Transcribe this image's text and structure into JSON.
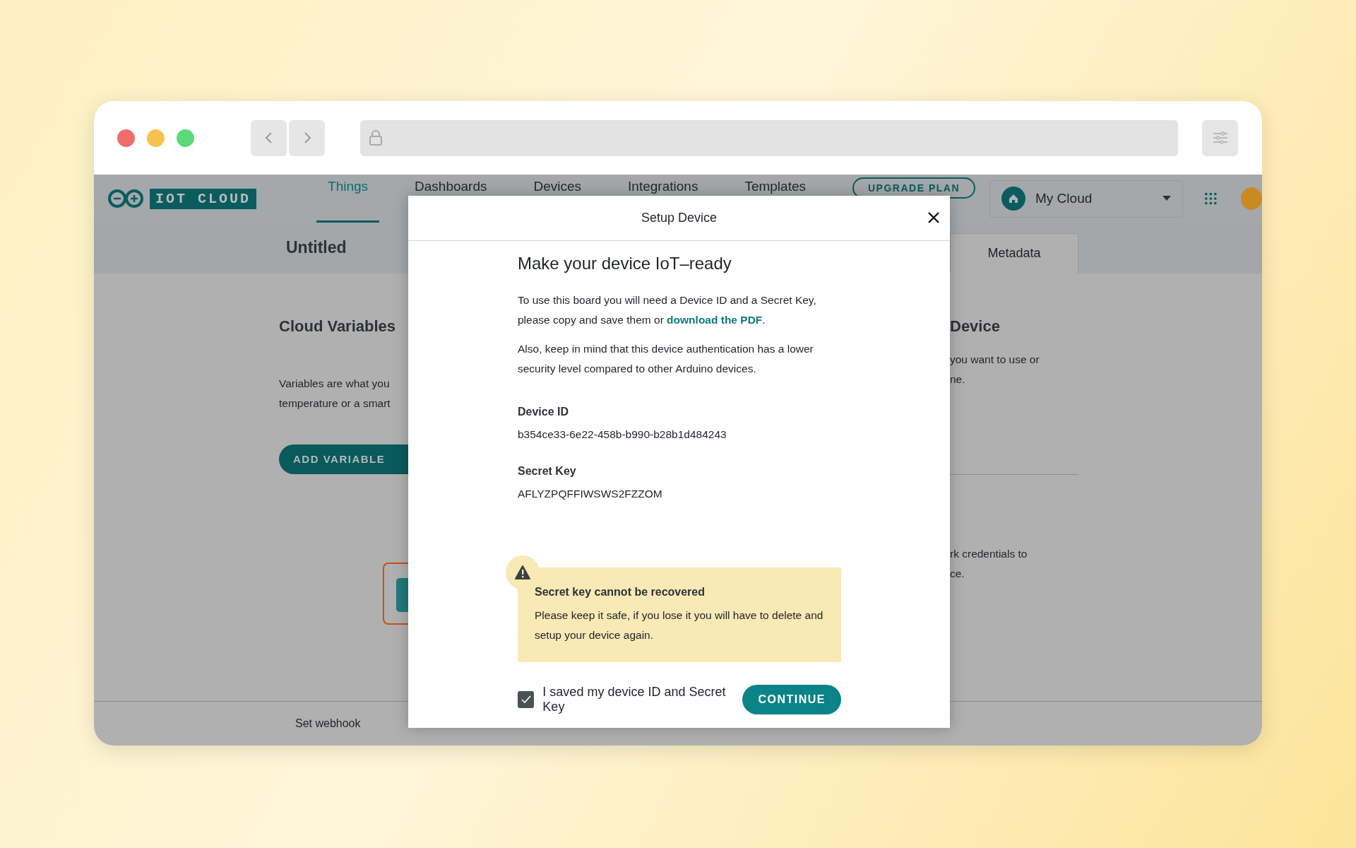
{
  "browser": {
    "traffic_lights": [
      {
        "color": "#f26b6b"
      },
      {
        "color": "#f6c24f"
      },
      {
        "color": "#5dd879"
      }
    ]
  },
  "header": {
    "logo_text": "IOT CLOUD",
    "tabs": [
      {
        "label": "Things",
        "selected": true
      },
      {
        "label": "Dashboards",
        "selected": false
      },
      {
        "label": "Devices",
        "selected": false
      },
      {
        "label": "Integrations",
        "selected": false
      },
      {
        "label": "Templates",
        "selected": false
      }
    ],
    "upgrade_button": "UPGRADE PLAN",
    "space": "My Cloud"
  },
  "subheader": {
    "title": "Untitled",
    "tab": "Metadata"
  },
  "left_panel": {
    "heading": "Cloud Variables",
    "lines": [
      "Variables are what you",
      "temperature or a smart"
    ],
    "button": "ADD VARIABLE"
  },
  "right_panel": {
    "heading": "Device",
    "lines": [
      "you want to use or",
      "ne."
    ],
    "lines_2": [
      "rk credentials to",
      "ce."
    ]
  },
  "footer": {
    "link": "Set webhook"
  },
  "modal": {
    "title": "Setup Device",
    "heading": "Make your device IoT–ready",
    "intro": {
      "text": "To use this board you will need a Device ID and a Secret Key, please copy and save them or ",
      "link": "download the PDF",
      "end": "."
    },
    "note": "Also, keep in mind that this device authentication has a lower security level compared to other Arduino devices.",
    "fields": [
      {
        "label": "Device ID",
        "value": "b354ce33-6e22-458b-b990-b28b1d484243"
      },
      {
        "label": "Secret Key",
        "value": "AFLYZPQFFIWSWS2FZZOM"
      }
    ],
    "warning": {
      "title": "Secret key cannot be recovered",
      "text": "Please keep it safe, if you lose it you will have to delete and setup your device again."
    },
    "confirm": {
      "label": "I saved my device ID and Secret Key",
      "checked": true
    },
    "continue_button": "CONTINUE"
  }
}
